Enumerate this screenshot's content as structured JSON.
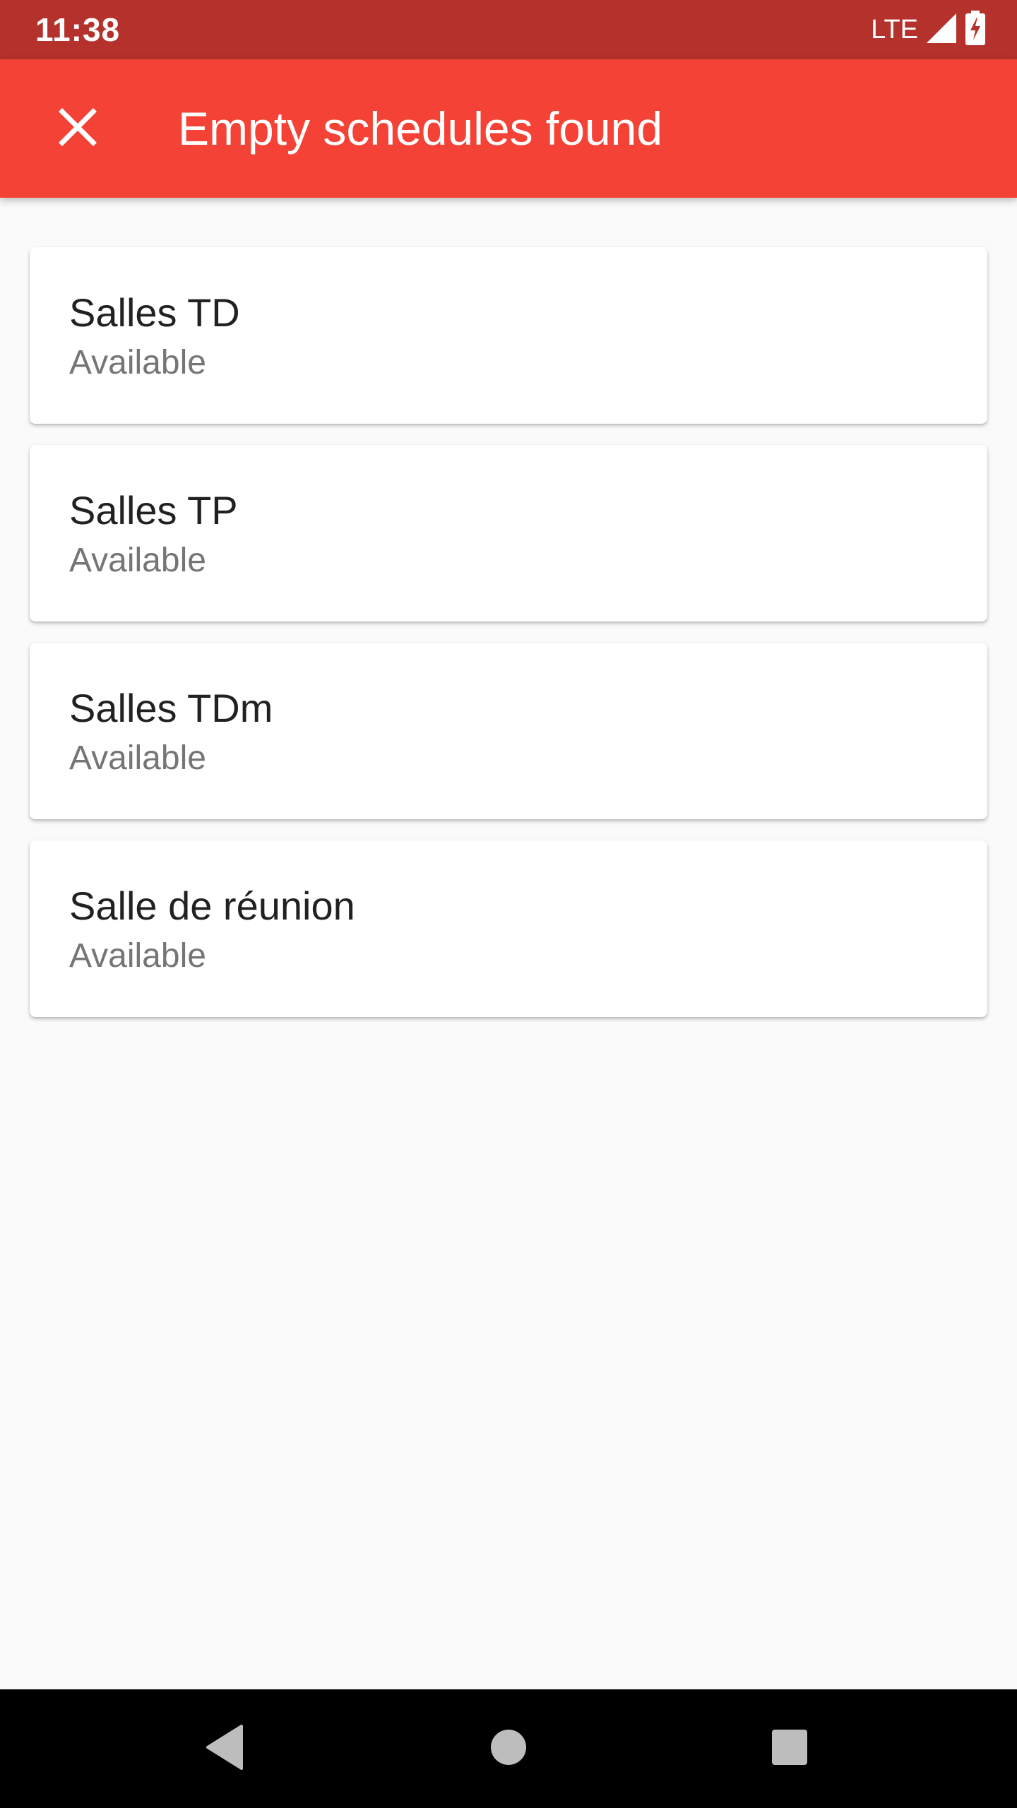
{
  "status_bar": {
    "time": "11:38",
    "network": "LTE"
  },
  "app_bar": {
    "title": "Empty schedules found",
    "close_icon": "close-icon"
  },
  "rooms": [
    {
      "name": "Salles TD",
      "status": "Available"
    },
    {
      "name": "Salles TP",
      "status": "Available"
    },
    {
      "name": "Salles TDm",
      "status": "Available"
    },
    {
      "name": "Salle de réunion",
      "status": "Available"
    }
  ],
  "nav_bar": {
    "back_icon": "back-triangle-icon",
    "home_icon": "home-circle-icon",
    "recents_icon": "recents-square-icon"
  },
  "colors": {
    "status_bar": "#b5312b",
    "app_bar": "#f44336",
    "background": "#fafafa"
  }
}
